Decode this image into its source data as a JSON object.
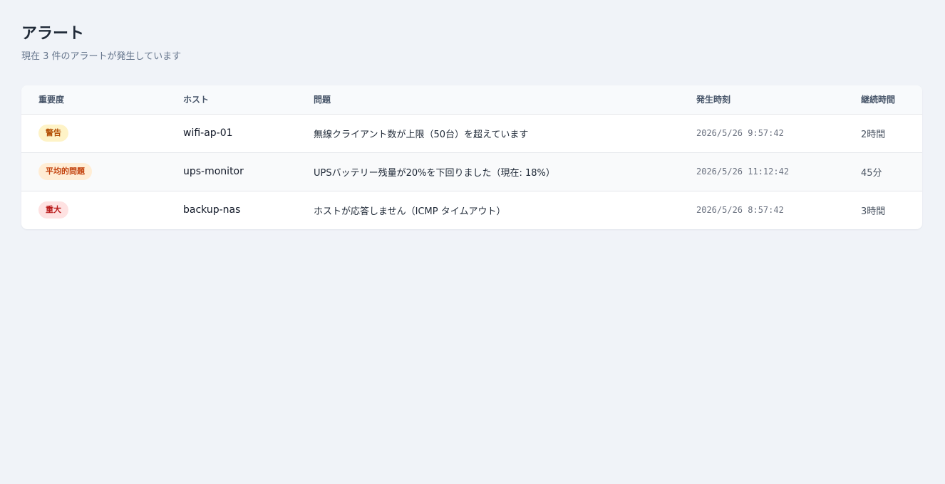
{
  "header": {
    "title": "アラート",
    "subtitle": "現在 3 件のアラートが発生しています"
  },
  "table": {
    "columns": [
      "重要度",
      "ホスト",
      "問題",
      "発生時刻",
      "継続時間"
    ],
    "rows": [
      {
        "severity": "警告",
        "severity_bg": "#fef3c7",
        "severity_color": "#b45309",
        "host": "wifi-ap-01",
        "issue": "無線クライアント数が上限（50台）を超えています",
        "time": "2026/5/26 9:57:42",
        "duration": "2時間"
      },
      {
        "severity": "平均的問題",
        "severity_bg": "#ffedd5",
        "severity_color": "#c2410c",
        "host": "ups-monitor",
        "issue": "UPSバッテリー残量が20%を下回りました（現在: 18%）",
        "time": "2026/5/26 11:12:42",
        "duration": "45分"
      },
      {
        "severity": "重大",
        "severity_bg": "#fee2e2",
        "severity_color": "#b91c1c",
        "host": "backup-nas",
        "issue": "ホストが応答しません（ICMP タイムアウト）",
        "time": "2026/5/26 8:57:42",
        "duration": "3時間"
      }
    ]
  }
}
